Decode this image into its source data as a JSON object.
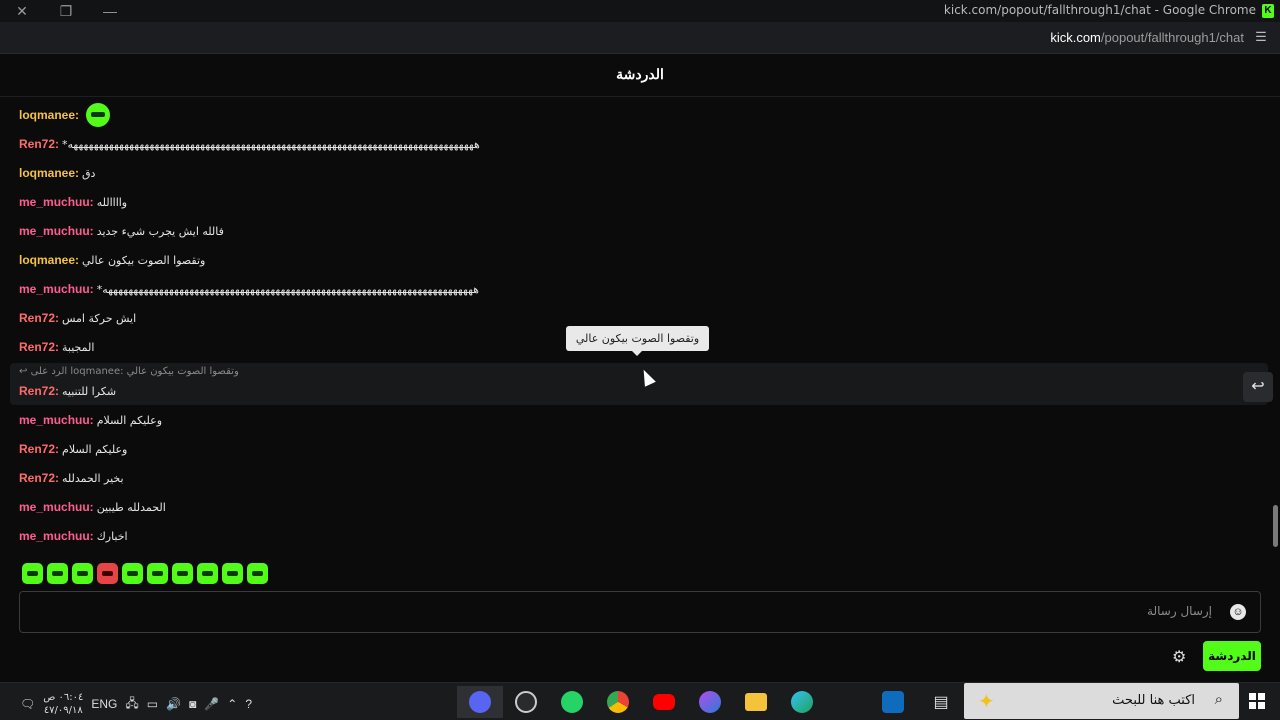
{
  "window": {
    "title": "kick.com/popout/fallthrough1/chat - Google Chrome",
    "controls": [
      "✕",
      "❐",
      "—"
    ]
  },
  "address_bar": {
    "host": "kick.com",
    "path": "/popout/fallthrough1/chat"
  },
  "chat": {
    "header_title": "الدردشة",
    "messages": [
      {
        "user": "loqmanee:",
        "text": "",
        "emote": true,
        "color": "gold"
      },
      {
        "user": "Ren72:",
        "text": "*ههههههههههههههههههههههههههههههههههههههههههههههههههههههههههههههههههههههههههههههههه",
        "color": "ren"
      },
      {
        "user": "loqmanee:",
        "text": "دق",
        "color": "gold"
      },
      {
        "user": "me_muchuu:",
        "text": "واااالله",
        "color": "pink"
      },
      {
        "user": "me_muchuu:",
        "text": "فالله ايش يجرب شيء جديد",
        "color": "pink"
      },
      {
        "user": "loqmanee:",
        "text": "وتقصوا الصوت بيكون عالي",
        "color": "gold"
      },
      {
        "user": "me_muchuu:",
        "text": "*هههههههههههههههههههههههههههههههههههههههههههههههههههههههههههههههههههههههههه",
        "color": "pink"
      },
      {
        "user": "Ren72:",
        "text": "ايش حركة امس",
        "color": "ren"
      },
      {
        "user": "Ren72:",
        "text": "المجيبة",
        "color": "ren"
      },
      {
        "user": "Ren72:",
        "text": "شكرا للتنبيه",
        "color": "ren"
      },
      {
        "user": "me_muchuu:",
        "text": "وعليكم السلام",
        "color": "pink"
      },
      {
        "user": "Ren72:",
        "text": "وعليكم السلام",
        "color": "ren"
      },
      {
        "user": "Ren72:",
        "text": "بخير الحمدلله",
        "color": "ren"
      },
      {
        "user": "me_muchuu:",
        "text": "الحمدلله طيبين",
        "color": "pink"
      },
      {
        "user": "me_muchuu:",
        "text": "اخبارك",
        "color": "pink"
      }
    ],
    "reply_context": "الرد على loqmanee: وتقصوا الصوت بيكون عالي",
    "tooltip": "وتقصوا الصوت بيكون عالي",
    "reply_icon": "reply-icon",
    "input_placeholder": "إرسال رسالة",
    "send_button": "الدردشة",
    "colors": {
      "accent": "#53fc18",
      "gold": "#f5c243",
      "pink": "#ff5d8f",
      "ren": "#ff6b6b"
    }
  },
  "taskbar": {
    "lang": "ENG",
    "time": "٠٦:٠٤ ص",
    "date": "٤٧/٠٩/١٨",
    "search_text": "اكتب هنا للبحث"
  }
}
